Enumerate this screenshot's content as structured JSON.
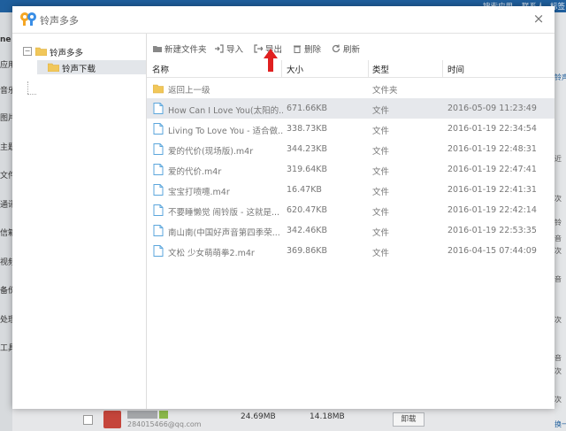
{
  "background": {
    "topbar": [
      "搜索应用",
      "联系人",
      "标签"
    ],
    "left_fragments": [
      "ne",
      "应用",
      "音乐",
      "图片",
      "主题",
      "文件",
      "通讯",
      "信箱",
      "视频",
      "备份",
      "处理",
      "工具"
    ],
    "right_fragments": [
      "铃声",
      "近",
      "次",
      "铃",
      "音",
      "次",
      "音",
      "次",
      "音",
      "次",
      "次",
      "换一"
    ],
    "bottom": {
      "email": "284015466@qq.com",
      "size1": "24.69MB",
      "size2": "14.18MB",
      "button": "卸载"
    }
  },
  "dialog": {
    "title": "铃声多多",
    "close_symbol": "×",
    "tree": {
      "root": "铃声多多",
      "child": "铃声下载",
      "toggle": "−"
    },
    "toolbar": {
      "new_folder": "新建文件夹",
      "import": "导入",
      "export": "导出",
      "delete": "删除",
      "refresh": "刷新"
    },
    "columns": {
      "name": "名称",
      "size": "大小",
      "type": "类型",
      "time": "时间"
    },
    "rows": [
      {
        "icon": "folder-icon",
        "name": "返回上一级",
        "size": "",
        "type": "文件夹",
        "time": ""
      },
      {
        "icon": "file-icon",
        "name": "How Can I Love You(太阳的...",
        "size": "671.66KB",
        "type": "文件",
        "time": "2016-05-09 11:23:49"
      },
      {
        "icon": "file-icon",
        "name": "Living To Love You - 适合做...",
        "size": "338.73KB",
        "type": "文件",
        "time": "2016-01-19 22:34:54"
      },
      {
        "icon": "file-icon",
        "name": "爱的代价(现场版).m4r",
        "size": "344.23KB",
        "type": "文件",
        "time": "2016-01-19 22:48:31"
      },
      {
        "icon": "file-icon",
        "name": "爱的代价.m4r",
        "size": "319.64KB",
        "type": "文件",
        "time": "2016-01-19 22:47:41"
      },
      {
        "icon": "file-icon",
        "name": "宝宝打喷嚏.m4r",
        "size": "16.47KB",
        "type": "文件",
        "time": "2016-01-19 22:41:31"
      },
      {
        "icon": "file-icon",
        "name": "不要睡懒觉 闹铃版 - 这就是...",
        "size": "620.47KB",
        "type": "文件",
        "time": "2016-01-19 22:42:14"
      },
      {
        "icon": "file-icon",
        "name": "南山南(中国好声音第四季荣...",
        "size": "342.46KB",
        "type": "文件",
        "time": "2016-01-19 22:53:35"
      },
      {
        "icon": "file-icon",
        "name": "文松 少女萌萌拳2.m4r",
        "size": "369.86KB",
        "type": "文件",
        "time": "2016-04-15 07:44:09"
      }
    ]
  },
  "colors": {
    "accent_blue": "#1f5f9d",
    "selection": "#e6e8ec",
    "folder_yellow": "#f1c75a",
    "file_blue": "#5ba6dc",
    "annotation_red": "#e02020"
  }
}
